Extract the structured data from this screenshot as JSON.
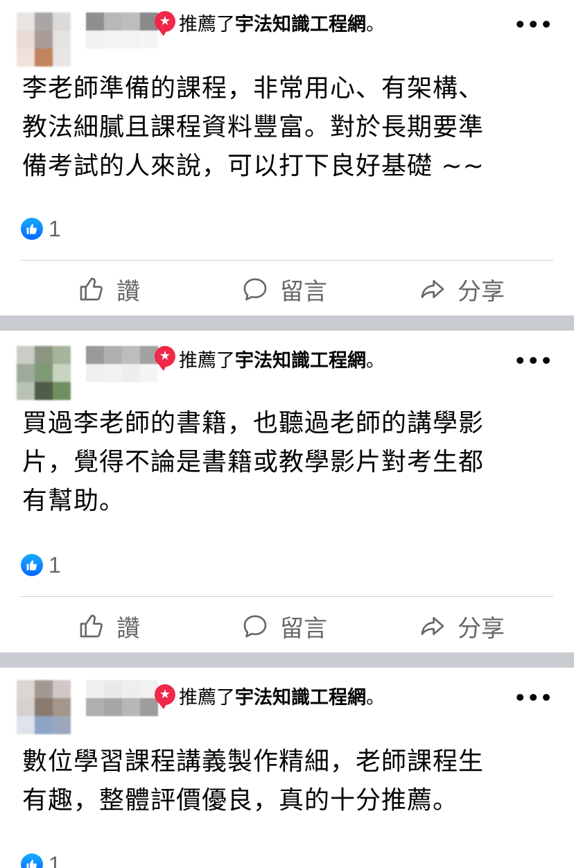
{
  "posts": [
    {
      "recommended_text": "推薦了",
      "page_name": "宇法知識工程網",
      "period": "。",
      "more": "•••",
      "content_lines": [
        "李老師準備的課程，非常用心、有架構、",
        "教法細膩且課程資料豐富。對於長期要準",
        "備考試的人來說，可以打下良好基礎 ~~"
      ],
      "like_count": "1",
      "actions": {
        "like": "讚",
        "comment": "留言",
        "share": "分享"
      }
    },
    {
      "recommended_text": "推薦了",
      "page_name": "宇法知識工程網",
      "period": "。",
      "more": "•••",
      "content_lines": [
        "買過李老師的書籍，也聽過老師的講學影",
        "片，覺得不論是書籍或教學影片對考生都",
        "有幫助。"
      ],
      "like_count": "1",
      "actions": {
        "like": "讚",
        "comment": "留言",
        "share": "分享"
      }
    },
    {
      "recommended_text": "推薦了",
      "page_name": "宇法知識工程網",
      "period": "。",
      "more": "•••",
      "content_lines": [
        "數位學習課程講義製作精細，老師課程生",
        "有趣，整體評價優良，真的十分推薦。"
      ],
      "like_count": "1"
    }
  ],
  "colors": {
    "recommend_badge": "#f02849",
    "like_blue": "#0866ff",
    "separator": "#c9ccd1",
    "secondary_text": "#65676b"
  }
}
